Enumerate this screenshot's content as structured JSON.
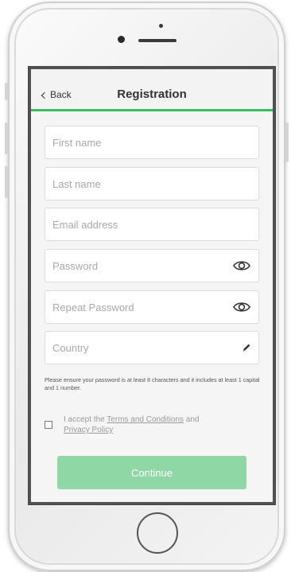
{
  "header": {
    "back_label": "Back",
    "title": "Registration"
  },
  "form": {
    "first_name": {
      "placeholder": "First name",
      "value": ""
    },
    "last_name": {
      "placeholder": "Last name",
      "value": ""
    },
    "email": {
      "placeholder": "Email address",
      "value": ""
    },
    "password": {
      "placeholder": "Password",
      "value": "",
      "icon": "eye-icon"
    },
    "repeat_password": {
      "placeholder": "Repeat Password",
      "value": "",
      "icon": "eye-icon"
    },
    "country": {
      "placeholder": "Country",
      "value": "",
      "icon": "pencil-icon"
    },
    "password_hint": "Please ensure your password is at least 8 characters and it includes at least 1 capital and 1 number.",
    "terms": {
      "prefix": "I accept the ",
      "terms_link": "Terms and Conditions",
      "middle": " and ",
      "privacy_link": "Privacy Policy",
      "checked": false
    },
    "continue_label": "Continue"
  },
  "colors": {
    "accent": "#3bba5e",
    "continue_button": "#8fd8a6"
  }
}
